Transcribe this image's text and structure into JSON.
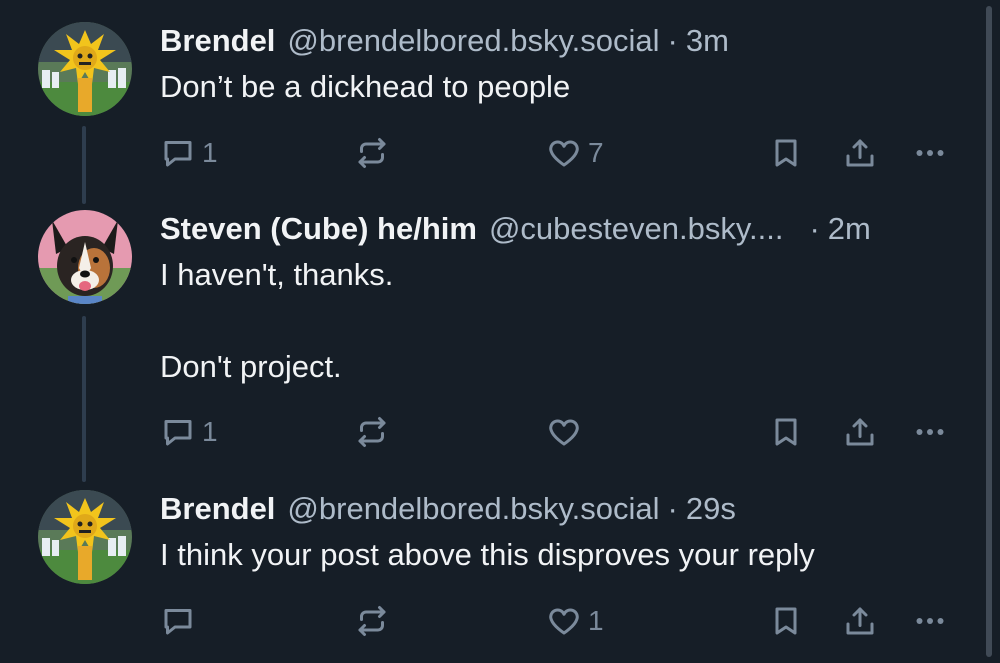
{
  "posts": [
    {
      "author": "Brendel",
      "handle": "@brendelbored.bsky.social",
      "separator": "·",
      "time": "3m",
      "text": [
        "Don’t be a dickhead to people"
      ],
      "reply_count": "1",
      "like_count": "7",
      "avatar": "cartoon-sun-mascot-avatar"
    },
    {
      "author": "Steven (Cube) he/him",
      "handle": "@cubesteven.bsky....",
      "separator": "·",
      "time": "2m",
      "text": [
        "I haven't, thanks.",
        "",
        "Don't project."
      ],
      "reply_count": "1",
      "like_count": "",
      "avatar": "dog-photo-avatar"
    },
    {
      "author": "Brendel",
      "handle": "@brendelbored.bsky.social",
      "separator": "·",
      "time": "29s",
      "text": [
        "I think your post above this disproves your reply"
      ],
      "reply_count": "",
      "like_count": "1",
      "avatar": "cartoon-sun-mascot-avatar"
    }
  ],
  "icons": {
    "reply": "speech-bubble-icon",
    "repost": "repost-icon",
    "like": "heart-icon",
    "bookmark": "bookmark-icon",
    "share": "share-icon",
    "more": "ellipsis-icon"
  },
  "colors": {
    "background": "#161e27",
    "text_primary": "#f1f3f5",
    "text_secondary": "#aebbc9",
    "icon": "#7b8a9b",
    "thread_line": "#2e3d4e"
  }
}
